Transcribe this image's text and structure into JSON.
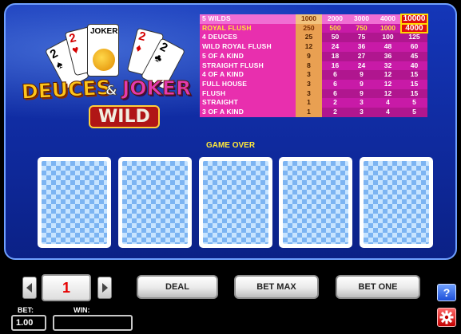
{
  "logo": {
    "word1": "DEUCES",
    "amp": "&",
    "word2": "JOKER",
    "word3": "WILD",
    "card_ranks": [
      "2",
      "2",
      "JOKER",
      "2",
      "2"
    ],
    "card_suits": [
      "♠",
      "♥",
      "",
      "♦",
      "♣"
    ]
  },
  "paytable": {
    "rows": [
      {
        "hand": "5 WILDS",
        "pays": [
          "1000",
          "2000",
          "3000",
          "4000",
          "10000"
        ]
      },
      {
        "hand": "ROYAL FLUSH",
        "pays": [
          "250",
          "500",
          "750",
          "1000",
          "4000"
        ]
      },
      {
        "hand": "4 DEUCES",
        "pays": [
          "25",
          "50",
          "75",
          "100",
          "125"
        ]
      },
      {
        "hand": "WILD ROYAL FLUSH",
        "pays": [
          "12",
          "24",
          "36",
          "48",
          "60"
        ]
      },
      {
        "hand": "5 OF A KIND",
        "pays": [
          "9",
          "18",
          "27",
          "36",
          "45"
        ]
      },
      {
        "hand": "STRAIGHT FLUSH",
        "pays": [
          "8",
          "16",
          "24",
          "32",
          "40"
        ]
      },
      {
        "hand": "4 OF A KIND",
        "pays": [
          "3",
          "6",
          "9",
          "12",
          "15"
        ]
      },
      {
        "hand": "FULL HOUSE",
        "pays": [
          "3",
          "6",
          "9",
          "12",
          "15"
        ]
      },
      {
        "hand": "FLUSH",
        "pays": [
          "3",
          "6",
          "9",
          "12",
          "15"
        ]
      },
      {
        "hand": "STRAIGHT",
        "pays": [
          "1",
          "2",
          "3",
          "4",
          "5"
        ]
      },
      {
        "hand": "3 OF A KIND",
        "pays": [
          "1",
          "2",
          "3",
          "4",
          "5"
        ]
      }
    ],
    "highlighted_bet_column": 1
  },
  "status": {
    "message": "GAME OVER"
  },
  "cards": [
    {
      "state": "face-down"
    },
    {
      "state": "face-down"
    },
    {
      "state": "face-down"
    },
    {
      "state": "face-down"
    },
    {
      "state": "face-down"
    }
  ],
  "controls": {
    "bet_level": "1",
    "deal_label": "DEAL",
    "bet_max_label": "BET MAX",
    "bet_one_label": "BET ONE",
    "bet_label": "BET:",
    "bet_value": "1.00",
    "win_label": "WIN:",
    "win_value": "",
    "help_label": "?",
    "prev_icon": "chevron-left-icon",
    "next_icon": "chevron-right-icon"
  },
  "colors": {
    "background": "#1436b8",
    "paytable_pink": "#e82fae",
    "paytable_orange": "#e9a052",
    "status_yellow": "#ffe93a",
    "bet_red": "#e60000"
  }
}
